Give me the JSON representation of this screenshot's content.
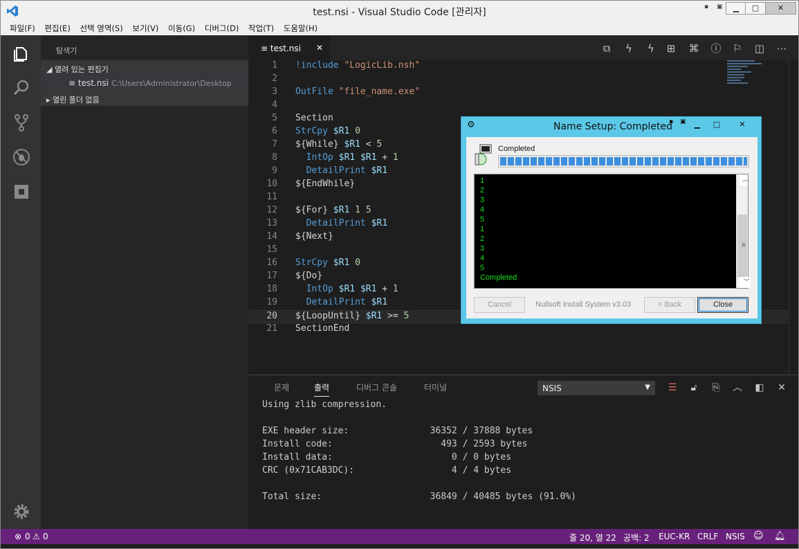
{
  "window": {
    "title": "test.nsi - Visual Studio Code [관리자]",
    "min": "▁",
    "max": "□",
    "close": "✕"
  },
  "menu": [
    "파일(F)",
    "편집(E)",
    "선택 영역(S)",
    "보기(V)",
    "이동(G)",
    "디버그(D)",
    "작업(T)",
    "도움말(H)"
  ],
  "sidebar": {
    "title": "탐색기",
    "open_editors": "열려 있는 편집기",
    "open_file": "test.nsi",
    "open_file_path": "C:\\Users\\Administrator\\Desktop",
    "no_folder": "열린 폴더 없음"
  },
  "tab": {
    "label": "test.nsi",
    "close": "✕"
  },
  "editor_lines": [
    {
      "n": "1",
      "t": "!include \"LogicLib.nsh\""
    },
    {
      "n": "2",
      "t": ""
    },
    {
      "n": "3",
      "t": "OutFile \"file_name.exe\""
    },
    {
      "n": "4",
      "t": ""
    },
    {
      "n": "5",
      "t": "Section"
    },
    {
      "n": "6",
      "t": "StrCpy $R1 0"
    },
    {
      "n": "7",
      "t": "${While} $R1 < 5"
    },
    {
      "n": "8",
      "t": "  IntOp $R1 $R1 + 1"
    },
    {
      "n": "9",
      "t": "  DetailPrint $R1"
    },
    {
      "n": "10",
      "t": "${EndWhile}"
    },
    {
      "n": "11",
      "t": ""
    },
    {
      "n": "12",
      "t": "${For} $R1 1 5"
    },
    {
      "n": "13",
      "t": "  DetailPrint $R1"
    },
    {
      "n": "14",
      "t": "${Next}"
    },
    {
      "n": "15",
      "t": ""
    },
    {
      "n": "16",
      "t": "StrCpy $R1 0"
    },
    {
      "n": "17",
      "t": "${Do}"
    },
    {
      "n": "18",
      "t": "  IntOp $R1 $R1 + 1"
    },
    {
      "n": "19",
      "t": "  DetailPrint $R1"
    },
    {
      "n": "20",
      "t": "${LoopUntil} $R1 >= 5"
    },
    {
      "n": "21",
      "t": "SectionEnd"
    }
  ],
  "panel": {
    "tabs": [
      "문제",
      "출력",
      "디버그 콘솔",
      "터미널"
    ],
    "select": "NSIS",
    "output": [
      "Using zlib compression.",
      "",
      "EXE header size:               36352 / 37888 bytes",
      "Install code:                    493 / 2593 bytes",
      "Install data:                      0 / 0 bytes",
      "CRC (0x71CAB3DC):                  4 / 4 bytes",
      "",
      "Total size:                    36849 / 40485 bytes (91.0%)"
    ]
  },
  "status": {
    "errors": "0",
    "warnings": "0",
    "position": "줄 20, 열 22",
    "spaces": "공백: 2",
    "encoding": "EUC-KR",
    "eol": "CRLF",
    "language": "NSIS"
  },
  "dialog": {
    "title": "Name Setup: Completed",
    "status": "Completed",
    "progress_percent": 100,
    "log": [
      "1",
      "2",
      "3",
      "4",
      "5",
      "1",
      "2",
      "3",
      "4",
      "5",
      "Completed"
    ],
    "cancel": "Cancel",
    "branding": "Nullsoft Install System v3.03",
    "back": "< Back",
    "close": "Close"
  },
  "colors": {
    "statusbar": "#68217a",
    "dialog_frame": "#5bc8e8",
    "progress": "#3c8fe0",
    "log_text": "#1ee01e"
  }
}
